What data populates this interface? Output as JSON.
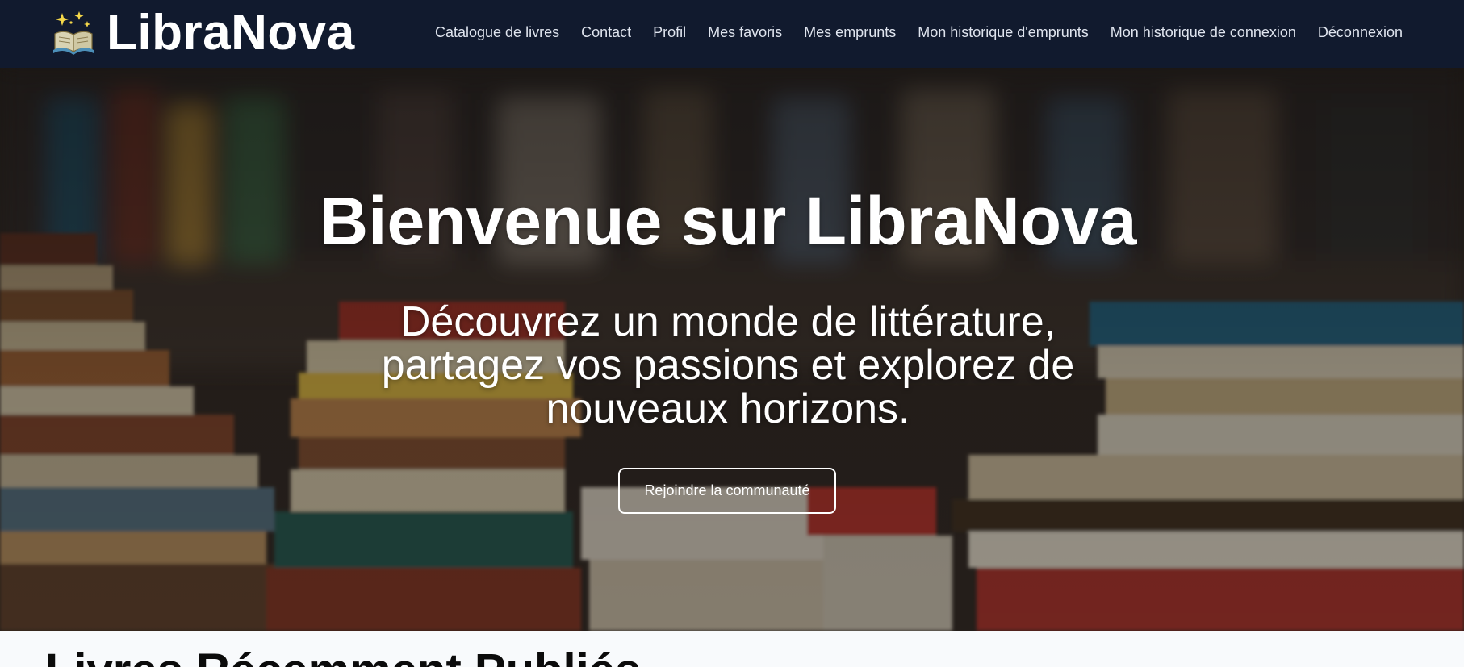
{
  "header": {
    "brand_name": "LibraNova",
    "brand_icon": "magic-book-icon",
    "nav": [
      {
        "label": "Catalogue de livres"
      },
      {
        "label": "Contact"
      },
      {
        "label": "Profil"
      },
      {
        "label": "Mes favoris"
      },
      {
        "label": "Mes emprunts"
      },
      {
        "label": "Mon historique d'emprunts"
      },
      {
        "label": "Mon historique de connexion"
      },
      {
        "label": "Déconnexion"
      }
    ]
  },
  "hero": {
    "title": "Bienvenue sur LibraNova",
    "subtitle": "Découvrez un monde de littérature, partagez vos passions et explorez de nouveaux horizons.",
    "cta_label": "Rejoindre la communauté",
    "background": "blurred-library-bookshelves-photo"
  },
  "recent": {
    "title": "Livres Récemment Publiés"
  },
  "colors": {
    "navbar_bg": "#111a2e",
    "nav_text": "#dfe4ee",
    "hero_text": "#ffffff",
    "page_bg": "#f8fafc"
  }
}
